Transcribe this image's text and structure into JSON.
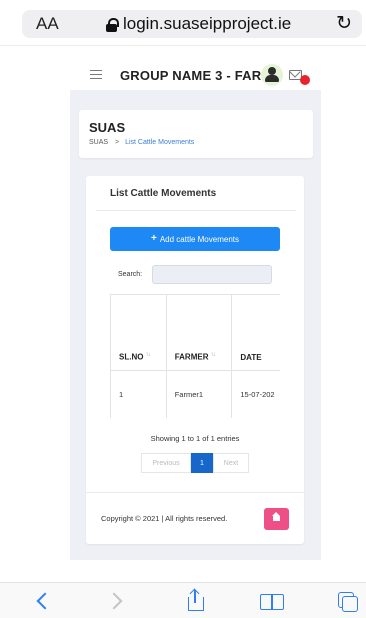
{
  "browser": {
    "text_size_label": "AA",
    "url": "login.suaseipproject.ie",
    "reload_glyph": "↻"
  },
  "header": {
    "group_name": "GROUP NAME 3 -  FAR1"
  },
  "page": {
    "title": "SUAS",
    "breadcrumb_root": "SUAS",
    "breadcrumb_sep": ">",
    "breadcrumb_current": "List Cattle Movements"
  },
  "card": {
    "title": "List Cattle Movements",
    "add_button_icon": "+",
    "add_button_label": "Add cattle Movements",
    "search_label": "Search:",
    "search_value": ""
  },
  "table": {
    "sort_glyph": "↑↓",
    "headers": [
      "SL.NO",
      "FARMER",
      "DATE"
    ],
    "rows": [
      [
        "1",
        "Farmer1",
        "15-07-202"
      ]
    ]
  },
  "pagination": {
    "entries_text": "Showing 1 to 1 of 1 entries",
    "previous_label": "Previous",
    "current_page": "1",
    "next_label": "Next"
  },
  "footer": {
    "copyright": "Copyright © 2021 | All rights reserved."
  },
  "icons": {
    "lock": "lock-icon",
    "reload": "reload-icon",
    "menu": "hamburger-menu-icon",
    "user": "user-settings-icon",
    "mail": "mail-icon",
    "home": "home-icon",
    "back": "back-arrow-icon",
    "forward": "forward-arrow-icon",
    "share": "share-icon",
    "bookmarks": "bookmarks-icon",
    "tabs": "tabs-icon"
  },
  "colors": {
    "primary_button": "#1e88f5",
    "active_page": "#1766c9",
    "home_button": "#ee4f87",
    "notification_badge": "#e8232b",
    "breadcrumb_link": "#3b7fd8",
    "safari_blue": "#2f7ef6"
  }
}
